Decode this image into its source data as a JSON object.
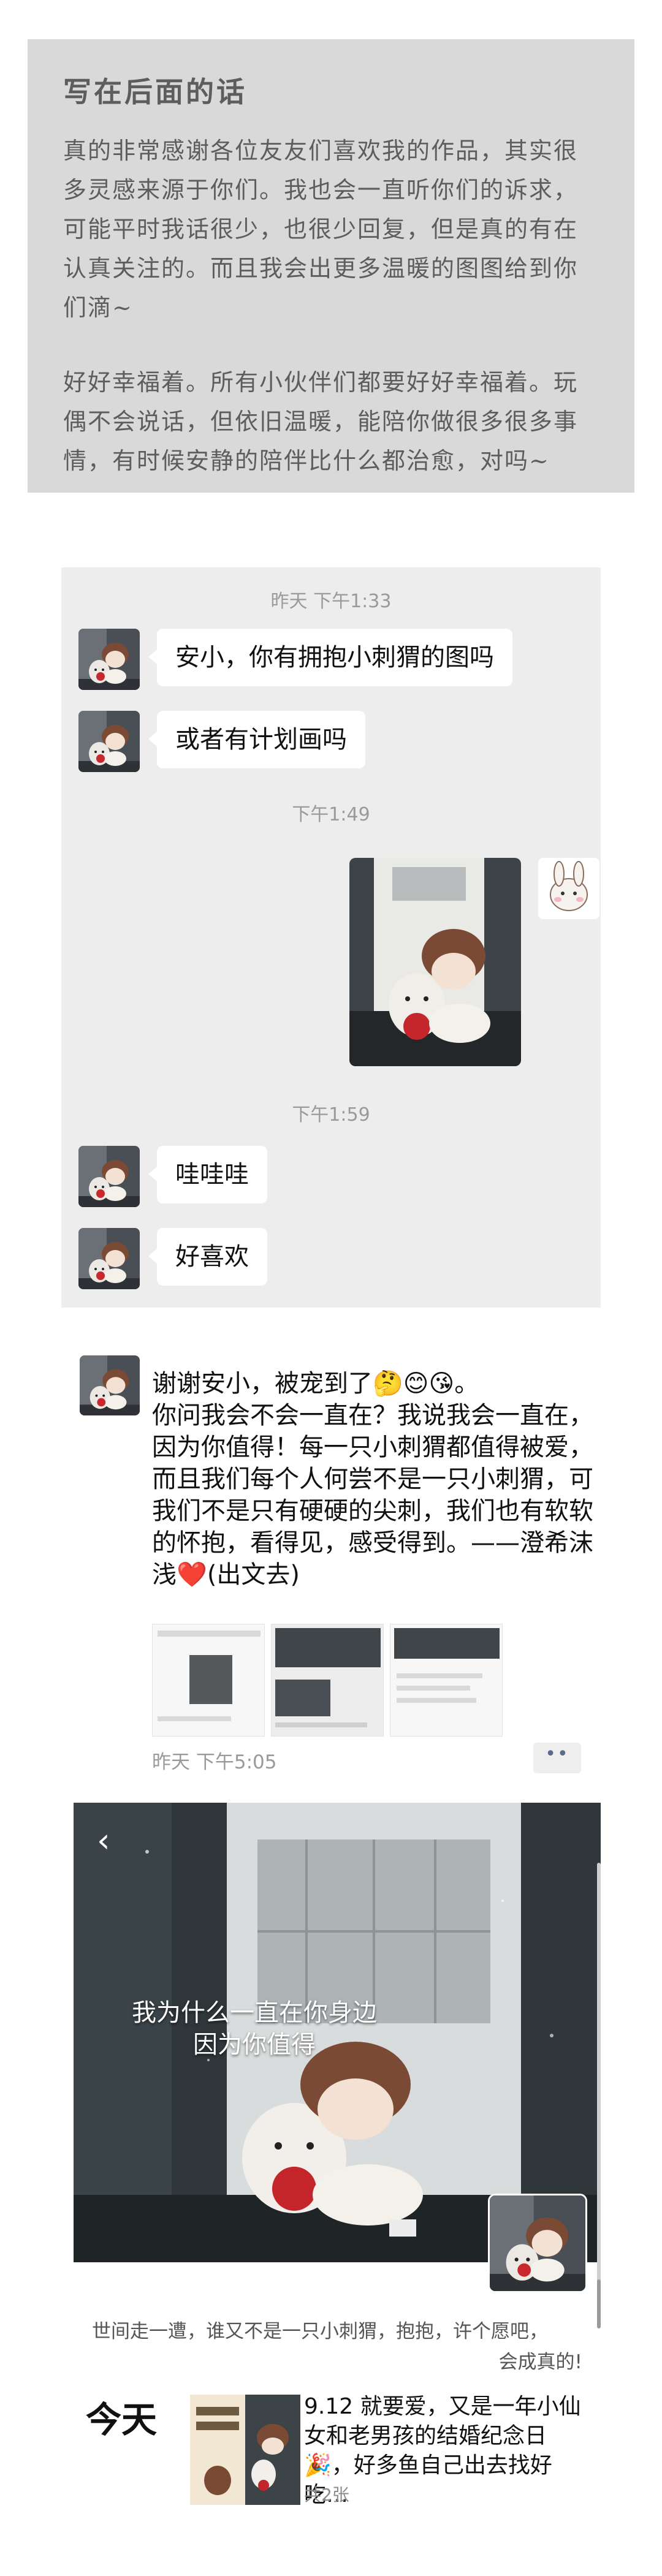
{
  "note": {
    "title": "写在后面的话",
    "paragraph1": "真的非常感谢各位友友们喜欢我的作品，其实很多灵感来源于你们。我也会一直听你们的诉求，可能平时我话很少，也很少回复，但是真的有在认真关注的。而且我会出更多温暖的图图给到你们滴~",
    "paragraph2": "好好幸福着。所有小伙伴们都要好好幸福着。玩偶不会说话，但依旧温暖，能陪你做很多很多事情，有时候安静的陪伴比什么都治愈，对吗~"
  },
  "chat": {
    "timestamps": [
      "昨天 下午1:33",
      "下午1:49",
      "下午1:59"
    ],
    "messages": [
      {
        "text": "安小，你有拥抱小刺猬的图吗"
      },
      {
        "text": "或者有计划画吗"
      },
      {
        "text": "哇哇哇"
      },
      {
        "text": "好喜欢"
      }
    ]
  },
  "post": {
    "line1": "谢谢安小，被宠到了🤔😊😘。",
    "body": "你问我会不会一直在？我说我会一直在，因为你值得！每一只小刺猬都值得被爱，而且我们每个人何尝不是一只小刺猬，可我们不是只有硬硬的尖刺，我们也有软软的怀抱，看得见，感受得到。——澄希沫浅",
    "heart": "❤️",
    "suffix": "(出文去)",
    "time": "昨天 下午5:05",
    "more": "••"
  },
  "video": {
    "caption_line1": "我为什么一直在你身边",
    "caption_line2": "因为你值得",
    "back_icon": "‹",
    "desc_line1": "世间走一遭，谁又不是一只小刺猬，抱抱，许个愿吧，",
    "desc_line2": "会成真的!"
  },
  "today": {
    "label": "今天",
    "text": "9.12 就要爱，又是一年小仙女和老男孩的结婚纪念日🎉，好多鱼自己出去找好吃…",
    "count": "共2张"
  },
  "colors": {
    "note_bg": "#d9d9d9",
    "chat_bg": "#ededed",
    "heart": "#e8576d",
    "link": "#596a8f"
  }
}
